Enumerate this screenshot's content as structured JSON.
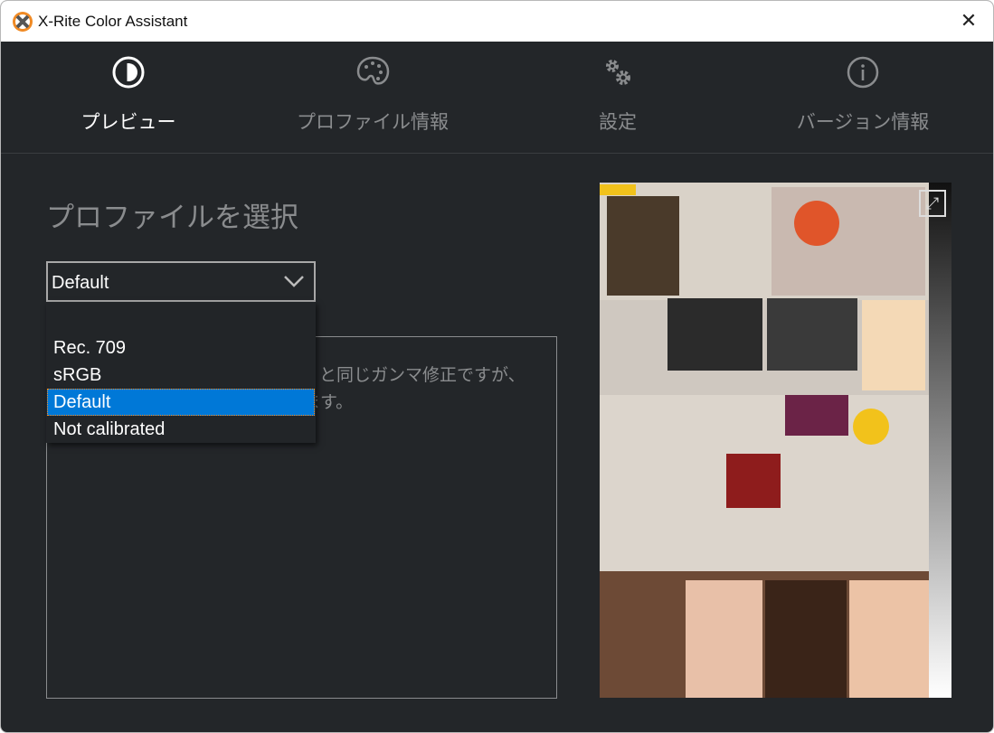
{
  "window": {
    "title": "X-Rite Color Assistant",
    "close_label": "✕"
  },
  "tabs": [
    {
      "label": "プレビュー",
      "icon": "contrast-icon",
      "active": true
    },
    {
      "label": "プロファイル情報",
      "icon": "palette-icon",
      "active": false
    },
    {
      "label": "設定",
      "icon": "gears-icon",
      "active": false
    },
    {
      "label": "バージョン情報",
      "icon": "info-icon",
      "active": false
    }
  ],
  "main": {
    "heading": "プロファイルを選択",
    "profile_select": {
      "value": "Default",
      "options": [
        "Rec. 709",
        "sRGB",
        "Default",
        "Not calibrated"
      ],
      "highlighted": "Default"
    },
    "description_fragments": [
      "B と同じガンマ修正ですが、",
      "ます。"
    ]
  },
  "preview": {
    "expand_icon": "expand-icon"
  },
  "colors": {
    "background": "#232629",
    "accent": "#0078d7",
    "focus": "#ff8c1a"
  }
}
